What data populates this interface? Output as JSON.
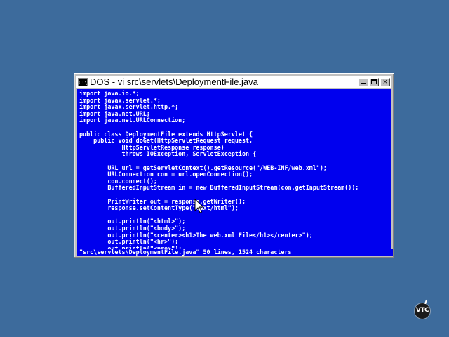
{
  "window": {
    "title": "DOS - vi src\\servlets\\DeploymentFile.java",
    "icon": "ms-dos-icon",
    "buttons": {
      "minimize": "minimize",
      "maximize": "maximize",
      "close": "×"
    }
  },
  "editor": {
    "lines": [
      "import java.io.*;",
      "import javax.servlet.*;",
      "import javax.servlet.http.*;",
      "import java.net.URL;",
      "import java.net.URLConnection;",
      "",
      "public class DeploymentFile extends HttpServlet {",
      "    public void doGet(HttpServletRequest request,",
      "            HttpServletResponse response)",
      "            throws IOException, ServletException {",
      "",
      "        URL url = getServletContext().getResource(\"/WEB-INF/web.xml\");",
      "        URLConnection con = url.openConnection();",
      "        con.connect();",
      "        BufferedInputStream in = new BufferedInputStream(con.getInputStream());",
      "",
      "        PrintWriter out = response.getWriter();",
      "        response.setContentType(\"text/html\");",
      "",
      "        out.println(\"<html>\");",
      "        out.println(\"<body>\");",
      "        out.println(\"<center><h1>The web.xml File</h1></center>\");",
      "        out.println(\"<hr>\");",
      "        out.println(\"<pre>\");"
    ],
    "status_line": "\"src\\servlets\\DeploymentFile.java\" 50 lines, 1524 characters"
  },
  "colors": {
    "desktop": "#3d6b9c",
    "console_bg": "#0000ee",
    "console_fg": "#ffffff",
    "window_chrome": "#c0c0c0"
  },
  "branding": {
    "logo": "VTC"
  }
}
